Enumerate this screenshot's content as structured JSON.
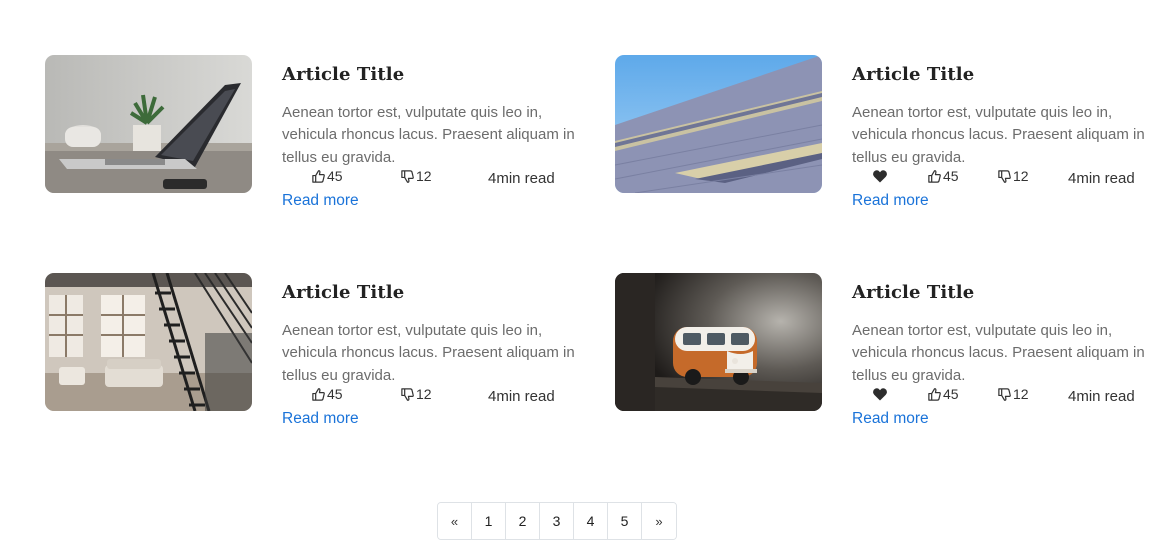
{
  "articles": [
    {
      "title": "Article Title",
      "excerpt": "Aenean tortor est, vulputate quis leo in, vehicula rhoncus lacus. Praesent aliquam in tellus eu gravida.",
      "likes": "45",
      "dislikes": "12",
      "read_time": "4min read",
      "read_more": "Read more",
      "image": "laptop-desk-photo",
      "favorited": false
    },
    {
      "title": "Article Title",
      "excerpt": "Aenean tortor est, vulputate quis leo in, vehicula rhoncus lacus. Praesent aliquam in tellus eu gravida.",
      "likes": "45",
      "dislikes": "12",
      "read_time": "4min read",
      "read_more": "Read more",
      "image": "building-facade-photo",
      "favorited": true
    },
    {
      "title": "Article Title",
      "excerpt": "Aenean tortor est, vulputate quis leo in, vehicula rhoncus lacus. Praesent aliquam in tellus eu gravida.",
      "likes": "45",
      "dislikes": "12",
      "read_time": "4min read",
      "read_more": "Read more",
      "image": "loft-interior-photo",
      "favorited": false
    },
    {
      "title": "Article Title",
      "excerpt": "Aenean tortor est, vulputate quis leo in, vehicula rhoncus lacus. Praesent aliquam in tellus eu gravida.",
      "likes": "45",
      "dislikes": "12",
      "read_time": "4min read",
      "read_more": "Read more",
      "image": "toy-van-photo",
      "favorited": true
    }
  ],
  "pagination": {
    "prev": "«",
    "pages": [
      "1",
      "2",
      "3",
      "4",
      "5"
    ],
    "next": "»"
  },
  "colors": {
    "link": "#1a73d9",
    "text": "#333333",
    "muted": "#6c6c6c",
    "border": "#dee2e6"
  },
  "icons": {
    "like": "thumbs-up-outline-icon",
    "dislike": "thumbs-down-outline-icon",
    "favorite": "heart-icon"
  }
}
